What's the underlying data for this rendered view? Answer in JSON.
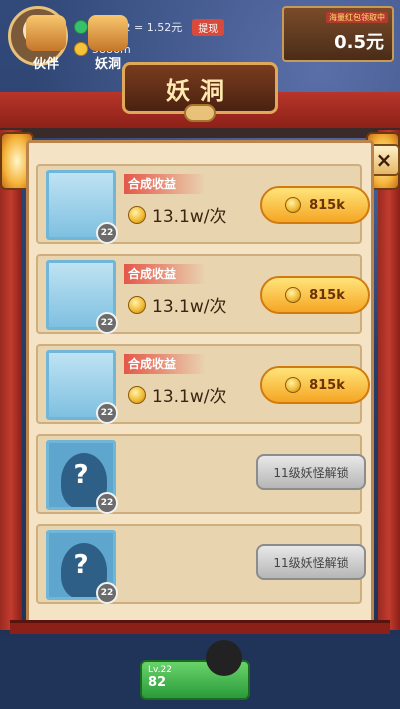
{
  "hud": {
    "currency": "15,112 = 1.52元",
    "withdraw_label": "提现",
    "distance": "5886m",
    "promo_tag": "海量红包领取中",
    "promo_amount": "0.5元"
  },
  "title": "妖洞",
  "close_label": "×",
  "slots": [
    {
      "state": "filled",
      "level": "22",
      "yield_label": "合成收益",
      "yield_value": "13.1w/次",
      "price": "815k"
    },
    {
      "state": "filled",
      "level": "22",
      "yield_label": "合成收益",
      "yield_value": "13.1w/次",
      "price": "815k"
    },
    {
      "state": "filled",
      "level": "22",
      "yield_label": "合成收益",
      "yield_value": "13.1w/次",
      "price": "815k"
    },
    {
      "state": "locked",
      "level": "22",
      "placeholder": "?",
      "unlock_label": "11级妖怪解锁"
    },
    {
      "state": "locked",
      "level": "22",
      "placeholder": "?",
      "unlock_label": "11级妖怪解锁"
    }
  ],
  "bottom": {
    "tab_partner": "伙伴",
    "tab_cave": "妖洞",
    "level_prefix": "Lv.22",
    "count": "82"
  },
  "colors": {
    "accent_red": "#c23b2e",
    "gold_button": "#f5a623",
    "panel_bg": "#f4e3c5",
    "portrait_border": "#6fb6d8"
  }
}
